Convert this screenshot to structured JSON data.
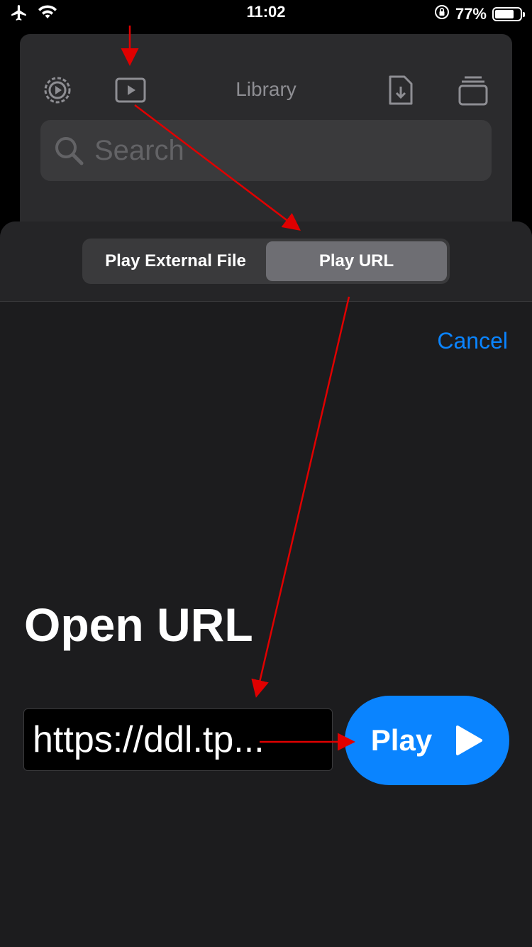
{
  "status_bar": {
    "time": "11:02",
    "battery_percent": "77%",
    "battery_level": 0.77,
    "icons": [
      "airplane-icon",
      "wifi-icon",
      "orientation-lock-icon",
      "battery-icon"
    ]
  },
  "library": {
    "title": "Library",
    "search_placeholder": "Search",
    "toolbar_icons": [
      "gear-icon",
      "play-rectangle-icon",
      "document-download-icon",
      "stack-icon"
    ]
  },
  "sheet": {
    "segments": [
      {
        "label": "Play External File",
        "active": false
      },
      {
        "label": "Play URL",
        "active": true
      }
    ],
    "cancel_label": "Cancel",
    "title": "Open URL",
    "url_value": "https://ddl.tp...",
    "play_label": "Play"
  },
  "colors": {
    "accent": "#0a84ff",
    "annotation": "#e00000",
    "sheet_bg": "#1c1c1e",
    "card_bg": "#2b2b2d"
  }
}
